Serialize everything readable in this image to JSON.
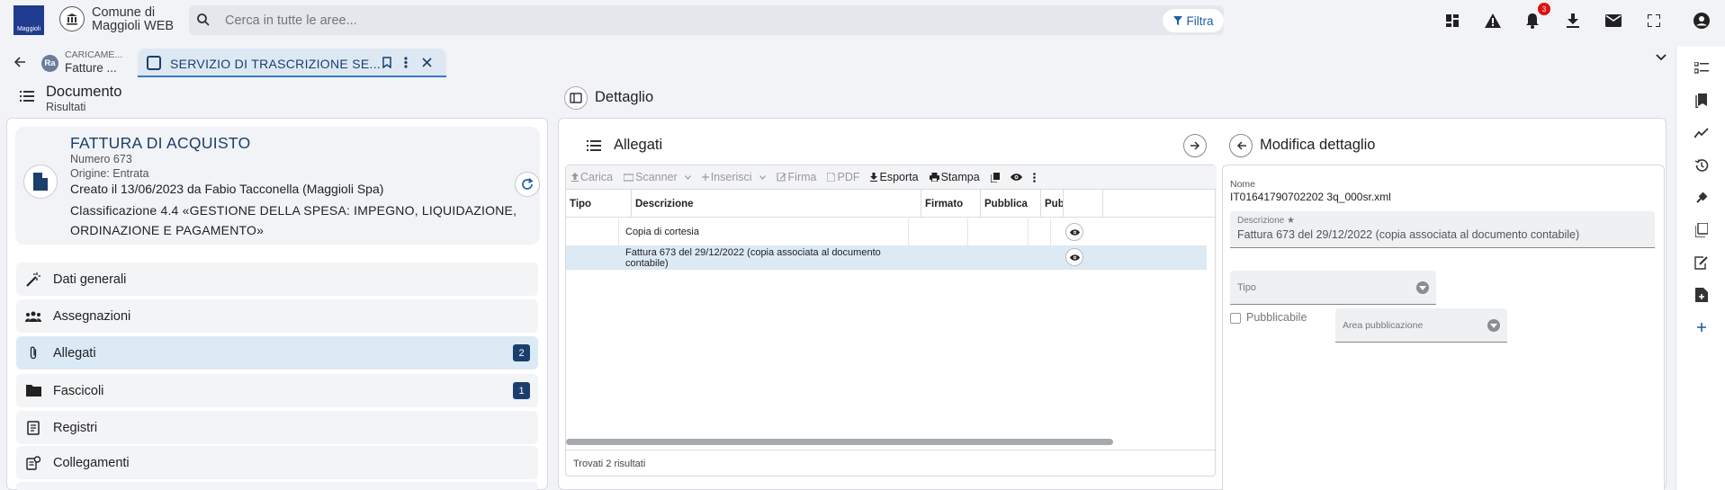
{
  "header": {
    "logo_text": "Maggioli",
    "app_title": "Comune di Maggioli WEB",
    "search_placeholder": "Cerca in tutte le aree...",
    "filter_label": "Filtra",
    "notification_count": "3"
  },
  "tabs": [
    {
      "icon_text": "Ra",
      "label_top": "CARICAME...",
      "label_bottom": "Fatture ..."
    },
    {
      "label": "SERVIZIO DI TRASCRIZIONE SE..."
    }
  ],
  "left": {
    "title": "Documento",
    "subtitle": "Risultati",
    "doc": {
      "title": "FATTURA DI ACQUISTO",
      "number": "Numero 673",
      "origin": "Origine: Entrata",
      "created": "Creato il 13/06/2023 da Fabio Tacconella (Maggioli Spa)",
      "classification": "Classificazione 4.4 «GESTIONE DELLA SPESA: IMPEGNO, LIQUIDAZIONE, ORDINAZIONE E PAGAMENTO»"
    },
    "menu": [
      {
        "label": "Dati generali",
        "icon": "magic-wand-icon"
      },
      {
        "label": "Assegnazioni",
        "icon": "group-icon"
      },
      {
        "label": "Allegati",
        "icon": "paperclip-icon",
        "badge": "2",
        "active": true
      },
      {
        "label": "Fascicoli",
        "icon": "folder-icon",
        "badge": "1"
      },
      {
        "label": "Registri",
        "icon": "register-icon"
      },
      {
        "label": "Collegamenti",
        "icon": "link-document-icon"
      }
    ]
  },
  "right": {
    "title": "Dettaglio",
    "attachments": {
      "title": "Allegati",
      "toolbar": {
        "carica": "Carica",
        "scanner": "Scanner",
        "inserisci": "Inserisci",
        "firma": "Firma",
        "pdf": "PDF",
        "esporta": "Esporta",
        "stampa": "Stampa"
      },
      "columns": [
        "Tipo",
        "Descrizione",
        "Firmato",
        "Pubblica",
        "Pubb"
      ],
      "rows": [
        {
          "tipo": "",
          "descrizione": "Copia di cortesia"
        },
        {
          "tipo": "",
          "descrizione": "Fattura 673 del 29/12/2022 (copia associata al documento contabile)"
        }
      ],
      "footer": "Trovati 2 risultati"
    },
    "edit": {
      "title": "Modifica dettaglio",
      "name_label": "Nome",
      "name_value": "IT01641790702202 3q_000sr.xml",
      "desc_label": "Descrizione",
      "desc_required": "★",
      "desc_value": "Fattura 673 del 29/12/2022 (copia associata al documento contabile)",
      "type_label": "Tipo",
      "publishable_label": "Pubblicabile",
      "area_label": "Area pubblicazione"
    }
  },
  "colors": {
    "accent": "#1b3f6d",
    "active_bg": "#dceaf6",
    "badge_red": "#dd1111"
  }
}
